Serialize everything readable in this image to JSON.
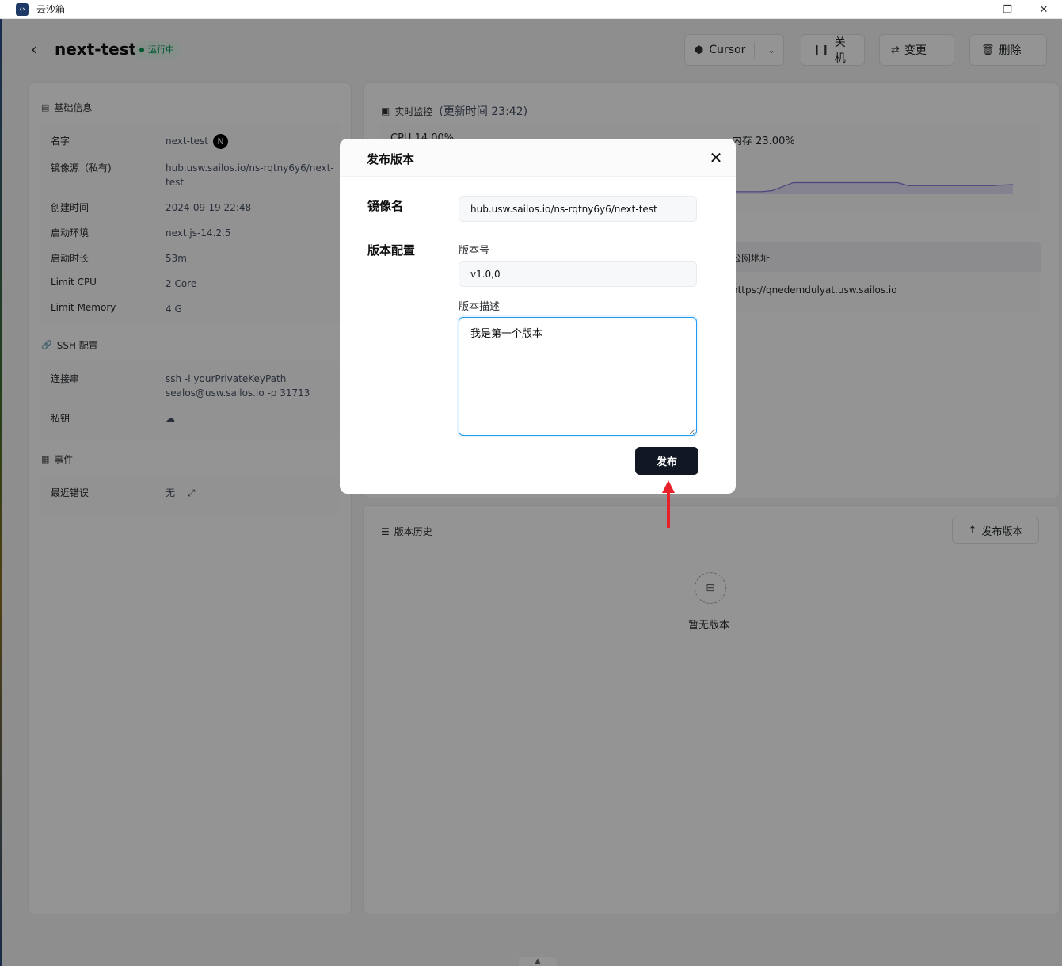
{
  "window": {
    "title": "云沙箱",
    "minimize": "–",
    "restore": "❐",
    "close": "✕"
  },
  "header": {
    "back": "‹",
    "name": "next-test",
    "status": "运行中",
    "buttons": {
      "cursor": "Cursor",
      "stop": "关机",
      "change": "变更",
      "delete": "删除"
    }
  },
  "basic_info": {
    "title": "基础信息",
    "rows": [
      {
        "key": "名字",
        "value": "next-test"
      },
      {
        "key": "镜像源（私有)",
        "value": "hub.usw.sailos.io/ns-rqtny6y6/next-test"
      },
      {
        "key": "创建时间",
        "value": "2024-09-19 22:48"
      },
      {
        "key": "启动环境",
        "value": "next.js-14.2.5"
      },
      {
        "key": "启动时长",
        "value": "53m"
      },
      {
        "key": "Limit CPU",
        "value": "2 Core"
      },
      {
        "key": "Limit Memory",
        "value": "4 G"
      }
    ],
    "framework_badge": "N"
  },
  "ssh": {
    "title": "SSH 配置",
    "conn_key": "连接串",
    "conn_value_1": "ssh -i yourPrivateKeyPath",
    "conn_value_2": "sealos@usw.sailos.io -p 31713",
    "key_key": "私钥"
  },
  "events": {
    "title": "事件",
    "recent_error_key": "最近错误",
    "recent_error_value": "无"
  },
  "monitor": {
    "title": "实时监控",
    "update_time": "(更新时间  23:42)",
    "cpu": "CPU 14.00%",
    "memory": "内存 23.00%",
    "memory_series": [
      0.05,
      0.05,
      0.05,
      0.05,
      0.05,
      0.1,
      0.3,
      0.5,
      0.5,
      0.5,
      0.5,
      0.5,
      0.5,
      0.5,
      0.5,
      0.5,
      0.5,
      0.5,
      0.35,
      0.35,
      0.35,
      0.35,
      0.35,
      0.35,
      0.35,
      0.35,
      0.35,
      0.38,
      0.4
    ]
  },
  "network": {
    "col_address": "公网地址",
    "address": "https://qnedemdulyat.usw.sailos.io"
  },
  "history": {
    "title": "版本历史",
    "publish_button": "发布版本",
    "empty": "暂无版本"
  },
  "modal": {
    "title": "发布版本",
    "image_label": "镜像名",
    "image_value": "hub.usw.sailos.io/ns-rqtny6y6/next-test",
    "version_config_label": "版本配置",
    "version_no_label": "版本号",
    "version_no_value": "v1.0,0",
    "desc_label": "版本描述",
    "desc_value": "我是第一个版本",
    "submit": "发布"
  },
  "colors": {
    "accent": "#219bf4",
    "status_green": "#039855",
    "primary_btn": "#111824",
    "annotation_red": "#e8202a"
  }
}
